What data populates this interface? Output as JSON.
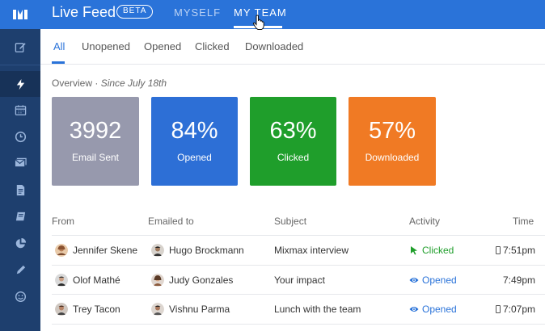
{
  "header": {
    "title": "Live Feed",
    "beta_label": "BETA",
    "tabs": [
      {
        "label": "MYSELF",
        "active": false
      },
      {
        "label": "MY TEAM",
        "active": true
      }
    ]
  },
  "sidebar": {
    "items": [
      {
        "icon": "compose-icon",
        "active": false
      },
      {
        "icon": "lightning-icon",
        "active": true
      },
      {
        "icon": "calendar-icon",
        "active": false
      },
      {
        "icon": "clock-icon",
        "active": false
      },
      {
        "icon": "inbox-icon",
        "active": false
      },
      {
        "icon": "document-icon",
        "active": false
      },
      {
        "icon": "book-icon",
        "active": false
      },
      {
        "icon": "pie-chart-icon",
        "active": false
      },
      {
        "icon": "pencil-icon",
        "active": false
      },
      {
        "icon": "smiley-icon",
        "active": false
      }
    ]
  },
  "filters": [
    "All",
    "Unopened",
    "Opened",
    "Clicked",
    "Downloaded"
  ],
  "active_filter": "All",
  "overview": {
    "label": "Overview",
    "since": "Since July 18th"
  },
  "stats": [
    {
      "value": "3992",
      "label": "Email Sent",
      "color": "#9799ad"
    },
    {
      "value": "84%",
      "label": "Opened",
      "color": "#2d6fd6"
    },
    {
      "value": "63%",
      "label": "Clicked",
      "color": "#1f9e2b"
    },
    {
      "value": "57%",
      "label": "Downloaded",
      "color": "#f07a24"
    }
  ],
  "table": {
    "headers": [
      "From",
      "Emailed to",
      "Subject",
      "Activity",
      "Time"
    ],
    "rows": [
      {
        "from": "Jennifer Skene",
        "to": "Hugo Brockmann",
        "subject": "Mixmax interview",
        "activity": "Clicked",
        "time": "7:51pm",
        "mobile": true
      },
      {
        "from": "Olof Mathé",
        "to": "Judy Gonzales",
        "subject": "Your impact",
        "activity": "Opened",
        "time": "7:49pm",
        "mobile": false
      },
      {
        "from": "Trey Tacon",
        "to": "Vishnu Parma",
        "subject": "Lunch with the team",
        "activity": "Opened",
        "time": "7:07pm",
        "mobile": true
      }
    ]
  },
  "colors": {
    "brand_blue": "#2a73d9",
    "sidebar": "#1e3f6e",
    "clicked_green": "#1f9e2b"
  }
}
